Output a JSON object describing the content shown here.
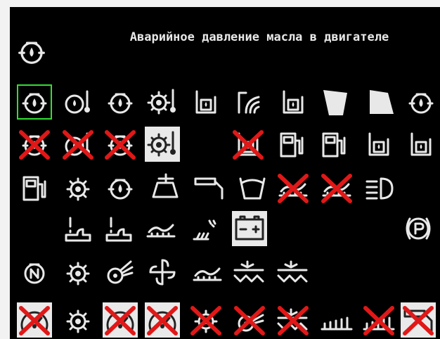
{
  "title": "Аварийное давление масла в двигателе",
  "selected_icon": "oil-pressure-icon",
  "colors": {
    "background": "#000000",
    "icon": "#e8e8e8",
    "cross": "#e01818",
    "selection": "#33dd33",
    "light_tile": "#e9e9e9"
  },
  "icons": [
    {
      "name": "oil-pressure-icon",
      "kind": "oilcan",
      "crossed": false,
      "light": false,
      "selected": true
    },
    {
      "name": "coolant-temp-icon",
      "kind": "tempdrop",
      "crossed": false,
      "light": false
    },
    {
      "name": "oil-level-icon",
      "kind": "oilcan",
      "crossed": false,
      "light": false
    },
    {
      "name": "gear-temp-icon",
      "kind": "geartemp",
      "crossed": false,
      "light": false
    },
    {
      "name": "hydraulic-temp-icon",
      "kind": "tank",
      "crossed": false,
      "light": false
    },
    {
      "name": "air-filter-icon",
      "kind": "filter",
      "crossed": false,
      "light": false
    },
    {
      "name": "hydraulic-oil-temp-icon",
      "kind": "tank",
      "crossed": false,
      "light": false
    },
    {
      "name": "concave-left-icon",
      "kind": "quadL",
      "crossed": false,
      "light": false
    },
    {
      "name": "concave-right-icon",
      "kind": "quadR",
      "crossed": false,
      "light": false
    },
    {
      "name": "hydraulic-pressure-icon",
      "kind": "oilcan",
      "crossed": false,
      "light": false
    },
    {
      "name": "oil-pressure-disabled-icon",
      "kind": "oilcan",
      "crossed": true,
      "light": false
    },
    {
      "name": "coolant-temp-disabled-icon",
      "kind": "tempdrop",
      "crossed": true,
      "light": false
    },
    {
      "name": "oil-level-disabled-icon",
      "kind": "oilcan",
      "crossed": true,
      "light": false
    },
    {
      "name": "gear-temp-warning-icon",
      "kind": "geartemp",
      "crossed": false,
      "light": true
    },
    {
      "name": "tank-disabled-icon",
      "kind": "tank",
      "crossed": true,
      "light": false
    },
    {
      "name": "fuel-pump-icon",
      "kind": "fuel",
      "crossed": false,
      "light": false
    },
    {
      "name": "fuel-pump-alt-icon",
      "kind": "fuel",
      "crossed": false,
      "light": false
    },
    {
      "name": "tank-level-icon",
      "kind": "tank",
      "crossed": false,
      "light": false
    },
    {
      "name": "tank-level-alt-icon",
      "kind": "tank",
      "crossed": false,
      "light": false
    },
    {
      "name": "fuel-level-icon",
      "kind": "fuel",
      "crossed": false,
      "light": false
    },
    {
      "name": "rotor-speed-icon",
      "kind": "gear",
      "crossed": false,
      "light": false
    },
    {
      "name": "engine-oil-icon",
      "kind": "oilcan",
      "crossed": false,
      "light": false
    },
    {
      "name": "grain-tank-unload-icon",
      "kind": "unload",
      "crossed": false,
      "light": false
    },
    {
      "name": "unloading-auger-icon",
      "kind": "auger",
      "crossed": false,
      "light": false
    },
    {
      "name": "grain-tank-full-icon",
      "kind": "bin",
      "crossed": false,
      "light": false
    },
    {
      "name": "header-disabled-icon",
      "kind": "header",
      "crossed": true,
      "light": false
    },
    {
      "name": "header-alt-disabled-icon",
      "kind": "header",
      "crossed": true,
      "light": false
    },
    {
      "name": "headlight-icon",
      "kind": "headlight",
      "crossed": false,
      "light": false
    },
    {
      "name": "seat-warning-icon",
      "kind": "seat",
      "crossed": false,
      "light": false
    },
    {
      "name": "operator-seat-icon",
      "kind": "seat",
      "crossed": false,
      "light": false
    },
    {
      "name": "sieve-icon",
      "kind": "header",
      "crossed": false,
      "light": false
    },
    {
      "name": "chopper-icon",
      "kind": "chopper",
      "crossed": false,
      "light": false
    },
    {
      "name": "battery-icon",
      "kind": "battery",
      "crossed": false,
      "light": true
    },
    {
      "name": "parking-brake-icon",
      "kind": "parking",
      "crossed": false,
      "light": false
    },
    {
      "name": "neutral-icon",
      "kind": "neutral",
      "crossed": false,
      "light": false
    },
    {
      "name": "rotor-icon",
      "kind": "gear",
      "crossed": false,
      "light": false
    },
    {
      "name": "fan-icon",
      "kind": "fan",
      "crossed": false,
      "light": false
    },
    {
      "name": "beater-icon",
      "kind": "beater",
      "crossed": false,
      "light": false
    },
    {
      "name": "header-reel-icon",
      "kind": "header",
      "crossed": false,
      "light": false
    },
    {
      "name": "straw-walker-icon",
      "kind": "walker",
      "crossed": false,
      "light": false
    },
    {
      "name": "straw-walker-alt-icon",
      "kind": "walker",
      "crossed": false,
      "light": false
    },
    {
      "name": "speed-disabled-icon",
      "kind": "gauge",
      "crossed": true,
      "light": true
    },
    {
      "name": "rotor-low-icon",
      "kind": "gear",
      "crossed": false,
      "light": false
    },
    {
      "name": "speed-alt-disabled-icon",
      "kind": "gauge",
      "crossed": true,
      "light": true
    },
    {
      "name": "speed-third-disabled-icon",
      "kind": "gauge",
      "crossed": true,
      "light": true
    },
    {
      "name": "rotor-disabled-icon",
      "kind": "gear",
      "crossed": true,
      "light": false
    },
    {
      "name": "fan-disabled-icon",
      "kind": "fan",
      "crossed": true,
      "light": false
    },
    {
      "name": "walker-disabled-icon",
      "kind": "walker",
      "crossed": true,
      "light": false
    },
    {
      "name": "cutter-bar-icon",
      "kind": "comb",
      "crossed": false,
      "light": false
    },
    {
      "name": "cutter-bar-disabled-icon",
      "kind": "comb",
      "crossed": true,
      "light": false
    },
    {
      "name": "auger-disabled-icon",
      "kind": "auger",
      "crossed": true,
      "light": true
    }
  ]
}
